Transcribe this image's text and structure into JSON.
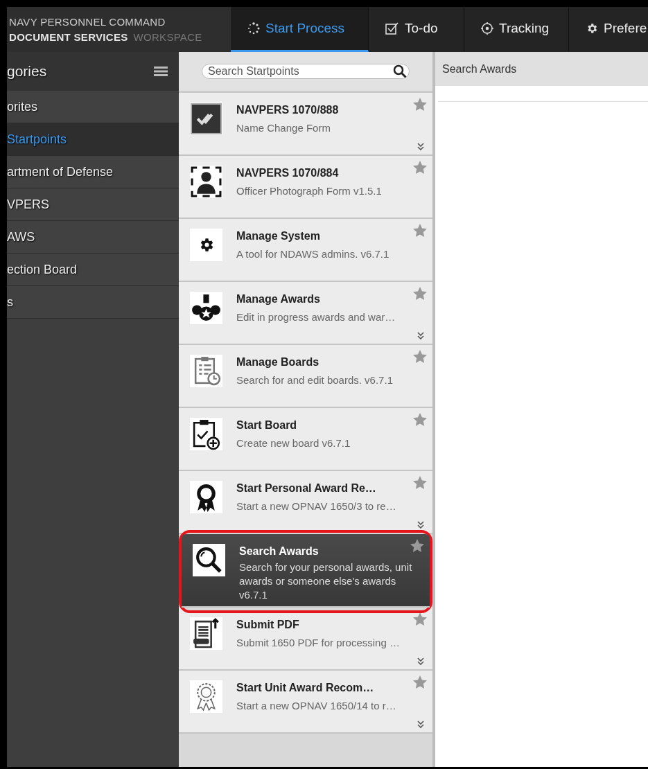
{
  "header": {
    "logo_line_1": "NAVY PERSONNEL COMMAND",
    "logo_line_2": "DOCUMENT SERVICES",
    "logo_line_2_suffix": "WORKSPACE",
    "tabs": [
      {
        "label": "Start Process",
        "kind": "spinner",
        "selected": true
      },
      {
        "label": "To-do",
        "kind": "checkbox",
        "selected": false
      },
      {
        "label": "Tracking",
        "kind": "target",
        "selected": false
      },
      {
        "label": "Prefere",
        "kind": "gear",
        "selected": false
      }
    ]
  },
  "sidebar": {
    "title": "gories",
    "items": [
      {
        "label": "orites",
        "selected": false
      },
      {
        "label": "Startpoints",
        "selected": true
      },
      {
        "label": "artment of Defense",
        "selected": false
      },
      {
        "label": "VPERS",
        "selected": false
      },
      {
        "label": "AWS",
        "selected": false
      },
      {
        "label": "ection Board",
        "selected": false
      },
      {
        "label": "s",
        "selected": false
      }
    ]
  },
  "startpoints": {
    "search": {
      "placeholder": "Search Startpoints"
    },
    "items": [
      {
        "title": "NAVPERS 1070/888",
        "description": "Name Change Form",
        "kind": "check",
        "expandable": true,
        "selected": false,
        "annotated": false
      },
      {
        "title": "NAVPERS 1070/884",
        "description": "Officer Photograph Form v1.5.1",
        "kind": "person",
        "expandable": false,
        "selected": false,
        "annotated": false
      },
      {
        "title": "Manage System",
        "description": "A tool for NDAWS admins. v6.7.1",
        "kind": "gear",
        "expandable": false,
        "selected": false,
        "annotated": false
      },
      {
        "title": "Manage Awards",
        "description": "Edit in progress awards and war…",
        "kind": "medal",
        "expandable": true,
        "selected": false,
        "annotated": false
      },
      {
        "title": "Manage Boards",
        "description": "Search for and edit boards. v6.7.1",
        "kind": "clipboard-clock",
        "expandable": false,
        "selected": false,
        "annotated": false
      },
      {
        "title": "Start Board",
        "description": "Create new board v6.7.1",
        "kind": "clipboard-plus",
        "expandable": false,
        "selected": false,
        "annotated": false
      },
      {
        "title": "Start Personal Award Re…",
        "description": "Start a new OPNAV 1650/3 to re…",
        "kind": "ribbon",
        "expandable": true,
        "selected": false,
        "annotated": false
      },
      {
        "title": "Search Awards",
        "description": "Search for your personal awards, unit awards or someone else's awards v6.7.1",
        "kind": "magnifier",
        "expandable": false,
        "selected": true,
        "annotated": true
      },
      {
        "title": "Submit PDF",
        "description": "Submit 1650 PDF for processing …",
        "kind": "pdf",
        "expandable": true,
        "selected": false,
        "annotated": false
      },
      {
        "title": "Start Unit Award Recom…",
        "description": "Start a new OPNAV 1650/14 to r…",
        "kind": "rosette",
        "expandable": true,
        "selected": false,
        "annotated": false
      }
    ]
  },
  "detail": {
    "title": "Search Awards"
  }
}
